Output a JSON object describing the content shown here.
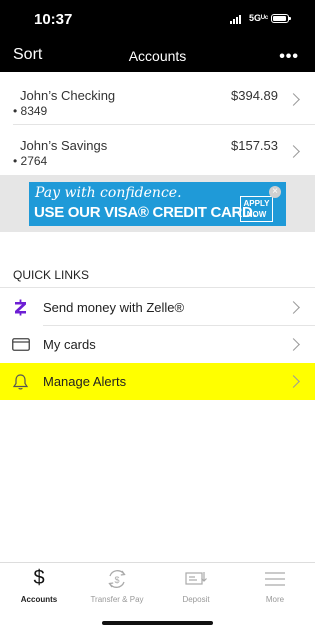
{
  "status": {
    "time": "10:37",
    "network": "5Gᵁᶜ"
  },
  "nav": {
    "sort_label": "Sort",
    "title": "Accounts",
    "more_label": "•••"
  },
  "accounts": [
    {
      "name": "John’s Checking",
      "number": "• 8349",
      "balance": "$394.89"
    },
    {
      "name": "John’s Savings",
      "number": "• 2764",
      "balance": "$157.53"
    }
  ],
  "promo": {
    "line1": "Pay with confidence.",
    "line2": "USE OUR VISA® CREDIT CARD.",
    "apply_line1": "APPLY",
    "apply_line2": "NOW",
    "close": "×",
    "bg_color": "#1f9ad8"
  },
  "quick_links": {
    "header": "QUICK LINKS",
    "items": [
      {
        "label": "Send money with Zelle®",
        "icon": "zelle-icon"
      },
      {
        "label": "My cards",
        "icon": "card-icon"
      },
      {
        "label": "Manage Alerts",
        "icon": "bell-icon",
        "highlighted": true
      }
    ],
    "highlight_color": "#ffff00"
  },
  "tabs": [
    {
      "label": "Accounts",
      "icon": "dollar-icon",
      "active": true
    },
    {
      "label": "Transfer & Pay",
      "icon": "transfer-icon",
      "active": false
    },
    {
      "label": "Deposit",
      "icon": "check-deposit-icon",
      "active": false
    },
    {
      "label": "More",
      "icon": "menu-icon",
      "active": false
    }
  ]
}
